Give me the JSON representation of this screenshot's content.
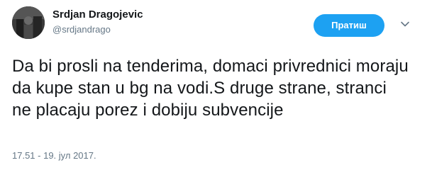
{
  "user": {
    "display_name": "Srdjan Dragojevic",
    "handle": "@srdjandrago"
  },
  "follow_button": {
    "label": "Пратиш"
  },
  "tweet": {
    "text": "Da bi prosli na tenderima, domaci privrednici moraju da kupe stan u bg na vodi.S druge strane, stranci ne placaju porez i dobiju subvencije",
    "timestamp": "17.51 - 19. јул 2017."
  },
  "icons": {
    "avatar": "profile-photo",
    "menu": "chevron-down-icon"
  },
  "colors": {
    "accent": "#1da1f2",
    "text_primary": "#14171a",
    "text_secondary": "#657786"
  }
}
